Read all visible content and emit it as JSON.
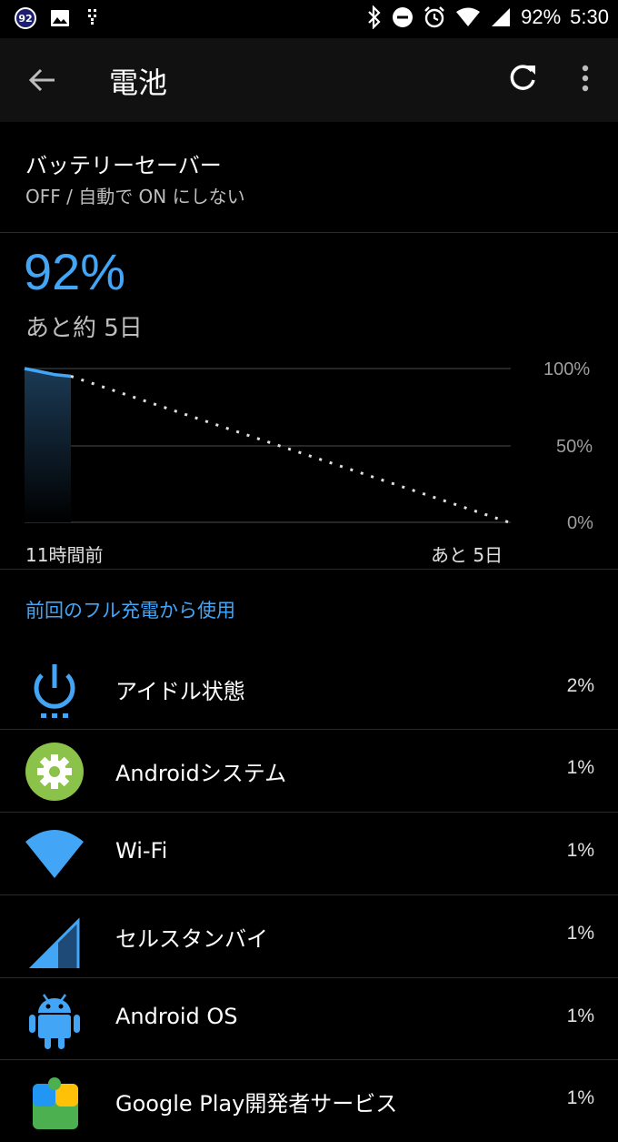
{
  "status_bar": {
    "badge": "92",
    "battery": "92%",
    "time": "5:30",
    "icons": [
      "notification-badge-icon",
      "image-icon",
      "usb-debug-icon",
      "bluetooth-icon",
      "do-not-disturb-icon",
      "alarm-icon",
      "wifi-icon",
      "signal-icon"
    ]
  },
  "app_bar": {
    "title": "電池",
    "icons": [
      "back-arrow-icon",
      "refresh-icon",
      "more-vert-icon"
    ]
  },
  "battery_saver": {
    "title": "バッテリーセーバー",
    "subtitle": "OFF / 自動で ON にしない"
  },
  "battery": {
    "percent": "92%",
    "remaining": "あと約 5日"
  },
  "chart_data": {
    "type": "line",
    "y_tick_labels": [
      "100%",
      "50%",
      "0%"
    ],
    "x_labels": [
      "11時間前",
      "あと 5日"
    ],
    "ylim": [
      0,
      100
    ],
    "series": [
      {
        "values": [
          100,
          98,
          96,
          95
        ]
      },
      {
        "values": [
          95,
          0
        ]
      }
    ],
    "grid": true,
    "accent": "#42a5f5"
  },
  "usage": {
    "header": "前回のフル充電から使用",
    "items": [
      {
        "name": "アイドル状態",
        "percent": "2%",
        "icon": "power-icon"
      },
      {
        "name": "Androidシステム",
        "percent": "1%",
        "icon": "settings-gear-icon"
      },
      {
        "name": "Wi-Fi",
        "percent": "1%",
        "icon": "wifi-icon"
      },
      {
        "name": "セルスタンバイ",
        "percent": "1%",
        "icon": "cell-signal-icon"
      },
      {
        "name": "Android OS",
        "percent": "1%",
        "icon": "android-icon"
      },
      {
        "name": "Google Play開発者サービス",
        "percent": "1%",
        "icon": "play-services-icon"
      }
    ]
  },
  "colors": {
    "accent": "#42a5f5",
    "background": "#000000",
    "app_bar": "#111111"
  }
}
